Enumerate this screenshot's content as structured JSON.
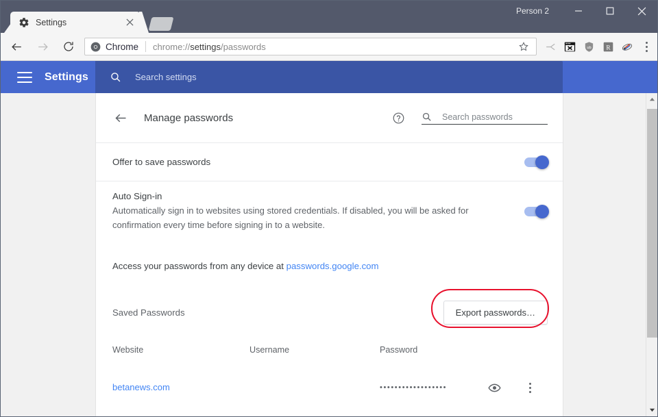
{
  "window": {
    "person_label": "Person 2",
    "minimize_icon": "minimize-icon",
    "maximize_icon": "maximize-icon",
    "close_icon": "close-icon"
  },
  "tab": {
    "title": "Settings",
    "favicon": "gear-icon",
    "close_icon": "close-icon",
    "newtab_icon": "new-tab-icon"
  },
  "toolbar": {
    "back_icon": "back-arrow-icon",
    "forward_icon": "forward-arrow-icon",
    "reload_icon": "reload-icon",
    "chrome_badge_label": "Chrome",
    "url_prefix": "chrome://",
    "url_bold": "settings",
    "url_suffix": "/passwords",
    "star_icon": "star-icon",
    "extensions": [
      {
        "name": "send-to-devices-icon",
        "label": ""
      },
      {
        "name": "black-box-x-icon",
        "label": ""
      },
      {
        "name": "ublock-shield-icon",
        "label": ""
      },
      {
        "name": "r-badge-icon",
        "label": "R"
      },
      {
        "name": "colorful-extension-icon",
        "label": ""
      },
      {
        "name": "chrome-menu-icon",
        "label": ""
      }
    ]
  },
  "settings_header": {
    "menu_icon": "hamburger-menu-icon",
    "title": "Settings",
    "search_icon": "search-icon",
    "search_placeholder": "Search settings",
    "bar_color": "#4668ce",
    "search_bg_color": "#3a55a5"
  },
  "page": {
    "back_icon": "back-arrow-icon",
    "title": "Manage passwords",
    "help_icon": "help-circle-icon",
    "search_icon": "search-icon",
    "search_placeholder": "Search passwords",
    "offer_to_save": {
      "label": "Offer to save passwords",
      "toggle_state": "on"
    },
    "auto_signin": {
      "label": "Auto Sign-in",
      "description": "Automatically sign in to websites using stored credentials. If disabled, you will be asked for confirmation every time before signing in to a website.",
      "toggle_state": "on"
    },
    "access_note": {
      "text": "Access your passwords from any device at ",
      "link_text": "passwords.google.com",
      "link_color": "#4285f4"
    },
    "saved_section": {
      "label": "Saved Passwords",
      "export_button": "Export passwords…",
      "highlight_color": "#e8112d"
    },
    "table": {
      "columns": [
        "Website",
        "Username",
        "Password"
      ],
      "rows": [
        {
          "website": "betanews.com",
          "username": "",
          "password_mask": "••••••••••••••••••",
          "show_icon": "eye-icon",
          "menu_icon": "more-vertical-icon"
        }
      ]
    }
  },
  "scrollbar": {
    "up_icon": "scroll-up-icon",
    "down_icon": "scroll-down-icon"
  }
}
